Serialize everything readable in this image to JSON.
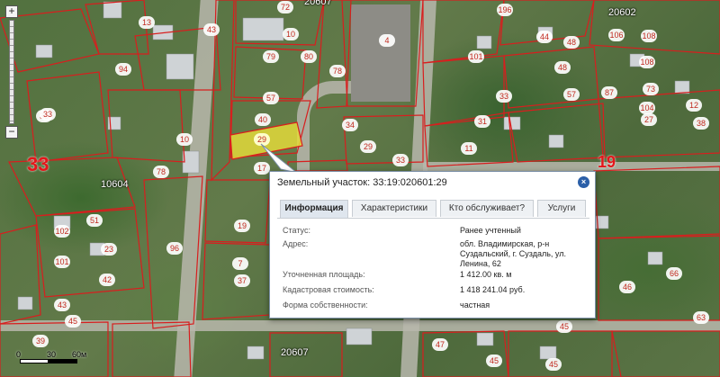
{
  "map": {
    "quarters": [
      "20607",
      "20602",
      "10604",
      "20607"
    ],
    "big_number": "33",
    "corner_number": "19",
    "parcels": [
      "196",
      "13",
      "108",
      "43",
      "72",
      "4",
      "10",
      "79",
      "80",
      "78",
      "101",
      "94",
      "48",
      "106",
      "108",
      "44",
      "48",
      "73",
      "87",
      "57",
      "104",
      "33",
      "36",
      "10",
      "12",
      "38",
      "57",
      "40",
      "31",
      "27",
      "29",
      "34",
      "33",
      "11",
      "17",
      "78",
      "96",
      "51",
      "19",
      "102",
      "101",
      "42",
      "43",
      "23",
      "7",
      "37",
      "45",
      "39",
      "47",
      "45",
      "45",
      "45",
      "46",
      "66",
      "63",
      "33"
    ]
  },
  "zoom": {
    "plus_label": "+",
    "minus_label": "−"
  },
  "scale": {
    "zero": "0",
    "mid": "30",
    "end": "60м"
  },
  "popup": {
    "title": "Земельный участок: 33:19:020601:29",
    "close_label": "×",
    "tabs": [
      {
        "label": "Информация",
        "active": true
      },
      {
        "label": "Характеристики",
        "active": false
      },
      {
        "label": "Кто обслуживает?",
        "active": false
      },
      {
        "label": "Услуги",
        "active": false
      }
    ],
    "fields": [
      {
        "key": "Статус:",
        "value": "Ранее учтенный"
      },
      {
        "key": "Адрес:",
        "value": "обл. Владимирская, р-н Суздальский, г. Суздаль, ул. Ленина, 62"
      },
      {
        "key": "Уточненная площадь:",
        "value": "1 412.00 кв. м"
      },
      {
        "key": "Кадастровая стоимость:",
        "value": "1 418 241.04 руб."
      },
      {
        "key": "Форма собственности:",
        "value": "частная"
      }
    ]
  },
  "selected_parcel": {
    "label": "29",
    "color": "#e3d93a"
  },
  "colors": {
    "boundary": "#d81e1e",
    "popup_border": "#7a8fa6",
    "close": "#2b5fa8"
  }
}
